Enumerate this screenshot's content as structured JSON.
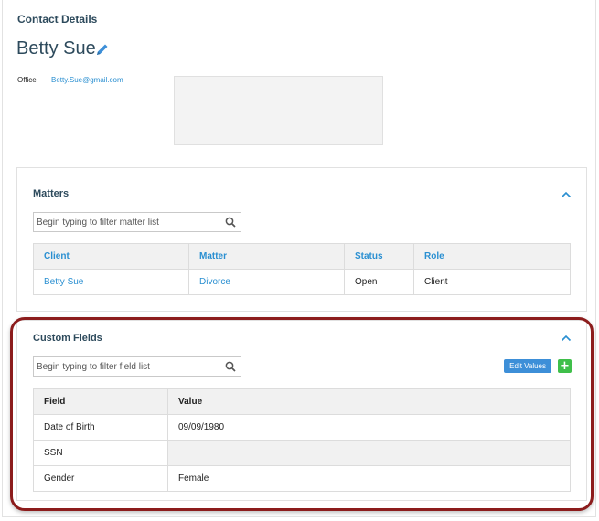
{
  "contact": {
    "section_title": "Contact Details",
    "name": "Betty Sue",
    "office_label": "Office",
    "office_email": "Betty.Sue@gmail.com"
  },
  "matters": {
    "title": "Matters",
    "filter_placeholder": "Begin typing to filter matter list",
    "columns": [
      "Client",
      "Matter",
      "Status",
      "Role"
    ],
    "rows": [
      [
        "Betty Sue",
        "Divorce",
        "Open",
        "Client"
      ]
    ]
  },
  "custom_fields": {
    "title": "Custom Fields",
    "filter_placeholder": "Begin typing to filter field list",
    "edit_values_label": "Edit Values",
    "add_label": "+",
    "columns": [
      "Field",
      "Value"
    ],
    "rows": [
      [
        "Date of Birth",
        "09/09/1980"
      ],
      [
        "SSN",
        ""
      ],
      [
        "Gender",
        "Female"
      ]
    ]
  },
  "colors": {
    "heading": "#2d4a5c",
    "link": "#2a8fd1",
    "edit_button": "#3d8fd8",
    "add_button": "#3fbf4a",
    "highlight": "#8c1c1c"
  }
}
